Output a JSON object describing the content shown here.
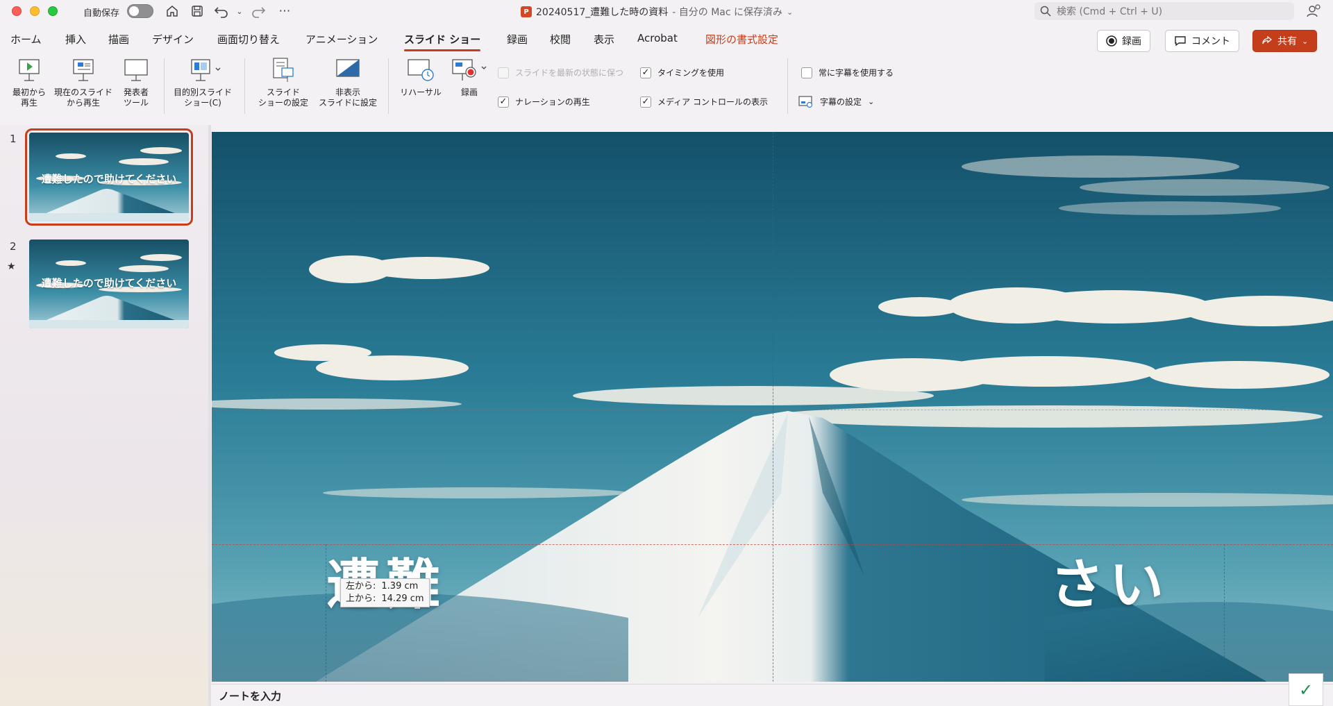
{
  "titlebar": {
    "autosave_label": "自動保存",
    "document_name": "20240517_遭難した時の資料",
    "save_status": " - 自分の Mac に保存済み",
    "search_placeholder": "検索 (Cmd + Ctrl + U)"
  },
  "tabs": [
    {
      "label": "ホーム"
    },
    {
      "label": "挿入"
    },
    {
      "label": "描画"
    },
    {
      "label": "デザイン"
    },
    {
      "label": "画面切り替え"
    },
    {
      "label": "アニメーション"
    },
    {
      "label": "スライド ショー",
      "active": true
    },
    {
      "label": "録画"
    },
    {
      "label": "校閲"
    },
    {
      "label": "表示"
    },
    {
      "label": "Acrobat"
    },
    {
      "label": "図形の書式設定",
      "accent": true
    }
  ],
  "header_buttons": {
    "record": "録画",
    "comment": "コメント",
    "share": "共有"
  },
  "ribbon": {
    "from_beginning": [
      "最初から",
      "再生"
    ],
    "from_current": [
      "現在のスライド",
      "から再生"
    ],
    "presenter_tools": [
      "発表者",
      "ツール"
    ],
    "custom_show": [
      "目的別スライド",
      "ショー(C)"
    ],
    "slideshow_setup": [
      "スライド",
      "ショーの設定"
    ],
    "hide_slide": [
      "非表示",
      "スライドに設定"
    ],
    "rehearse": "リハーサル",
    "record": "録画",
    "keep_updated": "スライドを最新の状態に保つ",
    "play_narration": "ナレーションの再生",
    "use_timings": "タイミングを使用",
    "show_media_controls": "メディア コントロールの表示",
    "always_subtitles": "常に字幕を使用する",
    "subtitle_settings": "字幕の設定"
  },
  "checkbox_states": {
    "keep_updated": false,
    "play_narration": true,
    "use_timings": true,
    "show_media_controls": true,
    "always_subtitles": false
  },
  "slides": [
    {
      "number": "1",
      "title": "遭難したので助けてください",
      "selected": true
    },
    {
      "number": "2",
      "title": "遭難したので助けてください",
      "selected": false
    }
  ],
  "canvas": {
    "title_left": "遭難",
    "title_right": "さい",
    "tooltip_left_label": "左から:",
    "tooltip_left_value": "1.39 cm",
    "tooltip_top_label": "上から:",
    "tooltip_top_value": "14.29 cm"
  },
  "notes_placeholder": "ノートを入力",
  "colors": {
    "accent": "#c43e1c",
    "sky_dark": "#14506a",
    "sky_light": "#3f90a6"
  }
}
